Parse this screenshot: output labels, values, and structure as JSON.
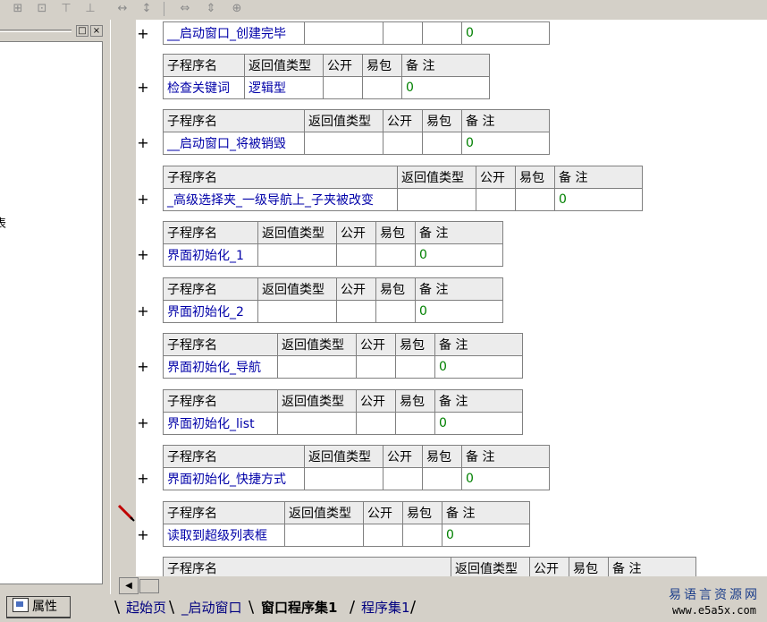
{
  "left_panel": {
    "stub_text": "表",
    "properties_tab": "属性"
  },
  "blocks": [
    {
      "name": "__启动窗口_创建完毕",
      "ret": "",
      "note": "0",
      "has_header": false
    },
    {
      "name": "检查关键词",
      "ret": "逻辑型",
      "note": "0",
      "has_header": true
    },
    {
      "name": "__启动窗口_将被销毁",
      "ret": "",
      "note": "0",
      "has_header": true
    },
    {
      "name": "_高级选择夹_一级导航上_子夹被改变",
      "ret": "",
      "note": "0",
      "has_header": true
    },
    {
      "name": "界面初始化_1",
      "ret": "",
      "note": "0",
      "has_header": true
    },
    {
      "name": "界面初始化_2",
      "ret": "",
      "note": "0",
      "has_header": true
    },
    {
      "name": "界面初始化_导航",
      "ret": "",
      "note": "0",
      "has_header": true
    },
    {
      "name": "界面初始化_list",
      "ret": "",
      "note": "0",
      "has_header": true
    },
    {
      "name": "界面初始化_快捷方式",
      "ret": "",
      "note": "0",
      "has_header": true
    },
    {
      "name": "读取到超级列表框",
      "ret": "",
      "note": "0",
      "has_header": true
    },
    {
      "name": "",
      "ret": "",
      "note": "",
      "has_header": true,
      "header_only": true
    }
  ],
  "headers": {
    "name": "子程序名",
    "ret": "返回值类型",
    "public": "公开",
    "easy": "易包",
    "note": "备 注"
  },
  "tabs": [
    "起始页",
    "_启动窗口",
    "窗口程序集1",
    "程序集1"
  ],
  "active_tab": "窗口程序集1",
  "watermark": {
    "line1": "易语言资源网",
    "line2": "www.e5a5x.com"
  }
}
